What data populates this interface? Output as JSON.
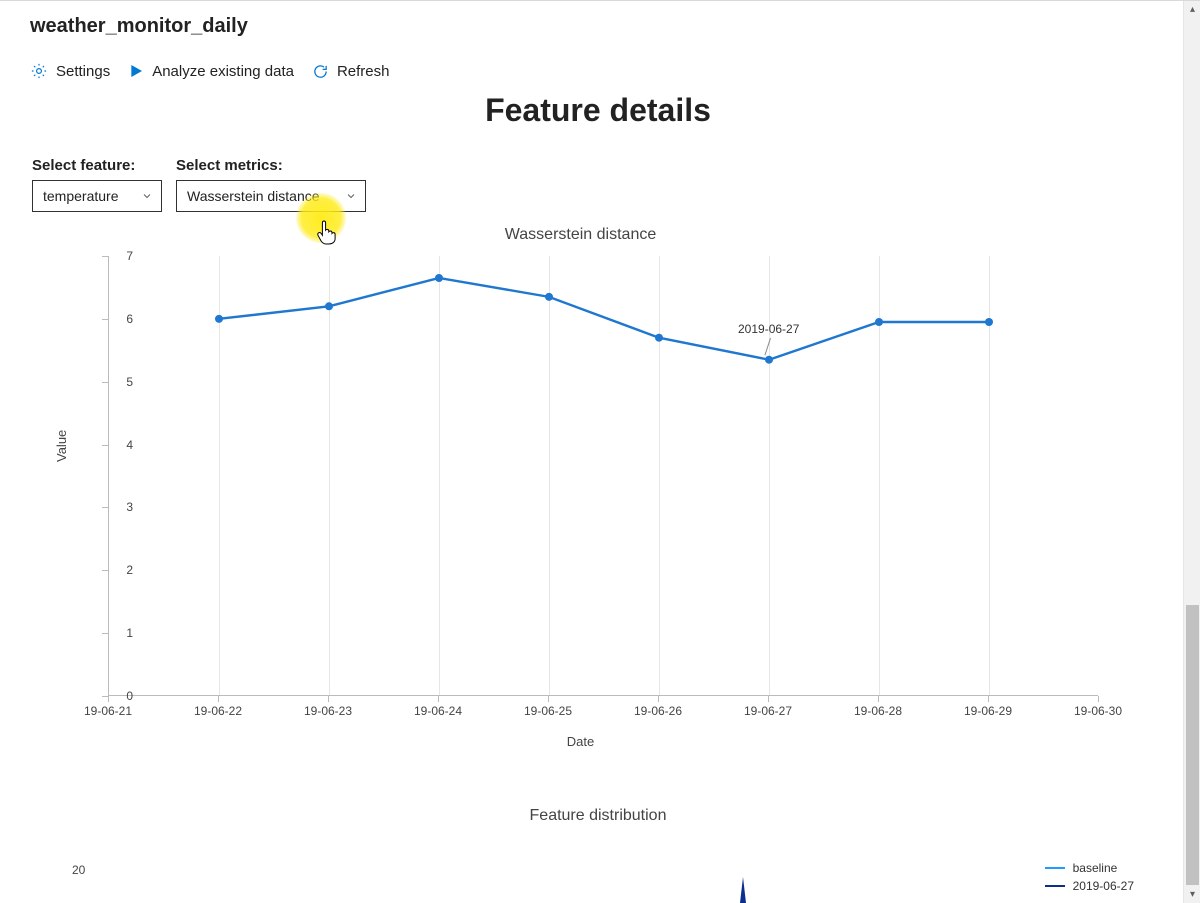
{
  "header": {
    "title": "weather_monitor_daily"
  },
  "toolbar": {
    "settings": "Settings",
    "analyze": "Analyze existing data",
    "refresh": "Refresh"
  },
  "section_title": "Feature details",
  "controls": {
    "feature_label": "Select feature:",
    "feature_value": "temperature",
    "metrics_label": "Select metrics:",
    "metrics_value": "Wasserstein distance"
  },
  "chart_data": {
    "type": "line",
    "title": "Wasserstein distance",
    "xlabel": "Date",
    "ylabel": "Value",
    "ylim": [
      0,
      7
    ],
    "yticks": [
      0,
      1,
      2,
      3,
      4,
      5,
      6,
      7
    ],
    "categories": [
      "19-06-21",
      "19-06-22",
      "19-06-23",
      "19-06-24",
      "19-06-25",
      "19-06-26",
      "19-06-27",
      "19-06-28",
      "19-06-29",
      "19-06-30"
    ],
    "series": [
      {
        "name": "Wasserstein distance",
        "x": [
          "19-06-22",
          "19-06-23",
          "19-06-24",
          "19-06-25",
          "19-06-26",
          "19-06-27",
          "19-06-28",
          "19-06-29"
        ],
        "values": [
          6.0,
          6.2,
          6.65,
          6.35,
          5.7,
          5.35,
          5.95,
          5.95
        ],
        "color": "#1f77d0"
      }
    ],
    "annotations": [
      {
        "text": "2019-06-27",
        "x": "19-06-27",
        "y": 5.35
      }
    ]
  },
  "dist_chart": {
    "title": "Feature distribution",
    "ytick": "20",
    "legend": [
      {
        "name": "baseline",
        "color": "#1f9bff"
      },
      {
        "name": "2019-06-27",
        "color": "#0b2f8a"
      }
    ]
  },
  "colors": {
    "accent": "#0078d4"
  }
}
